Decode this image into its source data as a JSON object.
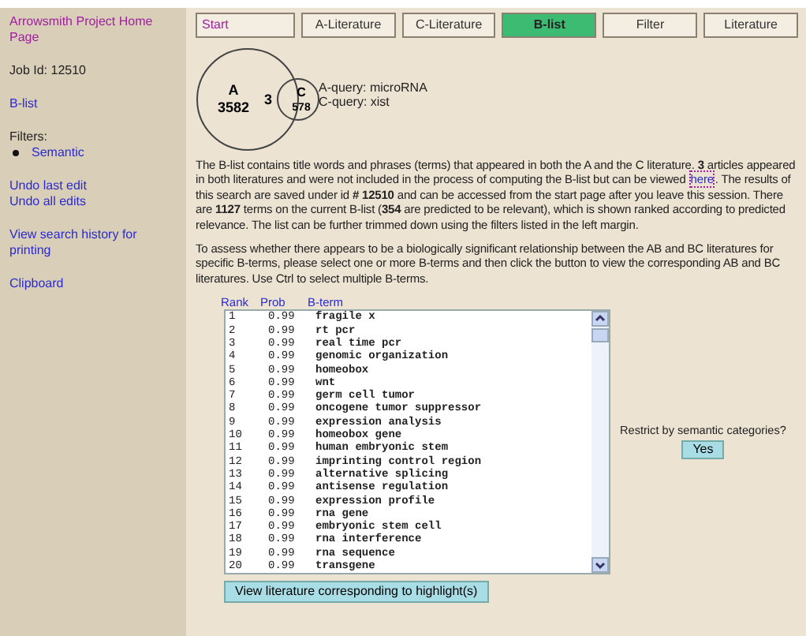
{
  "sidebar": {
    "home_link": "Arrowsmith Project Home Page",
    "job_id": "Job Id: 12510",
    "blist_link": "B-list",
    "filters_label": "Filters:",
    "filters": [
      "Semantic"
    ],
    "links": [
      [
        "Undo last edit",
        "Undo all edits"
      ],
      [
        "View search history for printing"
      ],
      [
        "Clipboard"
      ]
    ]
  },
  "tabs": [
    {
      "label": "Start",
      "selected": false,
      "visited": true
    },
    {
      "label": "A-Literature",
      "selected": false,
      "visited": false
    },
    {
      "label": "C-Literature",
      "selected": false,
      "visited": false
    },
    {
      "label": "B-list",
      "selected": true,
      "visited": false
    },
    {
      "label": "Filter",
      "selected": false,
      "visited": false
    },
    {
      "label": "Literature",
      "selected": false,
      "visited": false
    }
  ],
  "venn": {
    "a_label": "A",
    "a_count": "3582",
    "overlap": "3",
    "c_label": "C",
    "c_count": "578",
    "a_query": "A-query: microRNA",
    "c_query": "C-query: xist"
  },
  "intro": {
    "before": "The B-list contains title words and phrases (terms) that appeared in both the A and the C literature. **3** articles appeared in both literatures and were not included in the process of computing the B-list but can be viewed ",
    "link": "here",
    "after": ". The results of this search are saved under id **# 12510** and can be accessed from the start page after you leave this session. There are **1127** terms on the current B-list (**354** are predicted to be relevant), which is shown ranked according to predicted relevance. The list can be further trimmed down using the filters listed in the left margin."
  },
  "instructions": "To assess whether there appears to be a biologically significant relationship between the AB and BC literatures for specific B-terms, please select one or more B-terms and then click the button to view the corresponding AB and BC literatures. Use Ctrl to select multiple B-terms.",
  "table": {
    "columns": [
      "Rank",
      "Prob",
      "B-term"
    ],
    "rows": [
      [
        "1",
        "0.99",
        "fragile x"
      ],
      [
        "2",
        "0.99",
        "rt pcr"
      ],
      [
        "3",
        "0.99",
        "real time pcr"
      ],
      [
        "4",
        "0.99",
        "genomic organization"
      ],
      [
        "5",
        "0.99",
        "homeobox"
      ],
      [
        "6",
        "0.99",
        "wnt"
      ],
      [
        "7",
        "0.99",
        "germ cell tumor"
      ],
      [
        "8",
        "0.99",
        "oncogene tumor suppressor"
      ],
      [
        "9",
        "0.99",
        "expression analysis"
      ],
      [
        "10",
        "0.99",
        "homeobox gene"
      ],
      [
        "11",
        "0.99",
        "human embryonic stem"
      ],
      [
        "12",
        "0.99",
        "imprinting control region"
      ],
      [
        "13",
        "0.99",
        "alternative splicing"
      ],
      [
        "14",
        "0.99",
        "antisense regulation"
      ],
      [
        "15",
        "0.99",
        "expression profile"
      ],
      [
        "16",
        "0.99",
        "rna gene"
      ],
      [
        "17",
        "0.99",
        "embryonic stem cell"
      ],
      [
        "18",
        "0.99",
        "rna interference"
      ],
      [
        "19",
        "0.99",
        "rna sequence"
      ],
      [
        "20",
        "0.99",
        "transgene"
      ]
    ]
  },
  "view_button": "View literature corresponding to highlight(s)",
  "restrict": {
    "label": "Restrict by semantic categories?",
    "button": "Yes"
  }
}
